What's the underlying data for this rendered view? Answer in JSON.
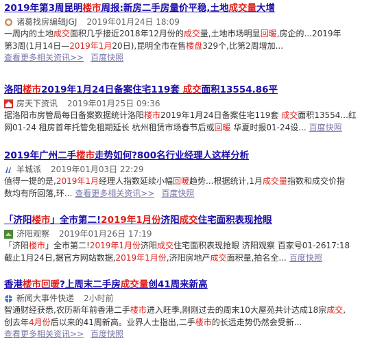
{
  "results": [
    {
      "title": [
        {
          "t": "2019年第3周昆明",
          "h": false
        },
        {
          "t": "楼市",
          "h": true
        },
        {
          "t": "周报:新房二手房量价平稳,土地",
          "h": false
        },
        {
          "t": "成交量",
          "h": true
        },
        {
          "t": "大增",
          "h": false
        }
      ],
      "source_icon": "clock-circle-icon",
      "source": "诸葛找房编辑JGJ",
      "date": "2019年01月24日 18:09",
      "desc_lines": [
        [
          {
            "t": "一周内的土地",
            "h": false
          },
          {
            "t": "成交",
            "h": true
          },
          {
            "t": "面积几乎接近2018年12月份的",
            "h": false
          },
          {
            "t": "成交",
            "h": true
          },
          {
            "t": "量,土地市场明显",
            "h": false
          },
          {
            "t": "回暖",
            "h": true
          },
          {
            "t": ",房企的...2019年",
            "h": false
          }
        ],
        [
          {
            "t": "第3周(1月14日—",
            "h": false
          },
          {
            "t": "2019年1月",
            "h": true
          },
          {
            "t": "20日),昆明全市在售",
            "h": false
          },
          {
            "t": "楼盘",
            "h": true
          },
          {
            "t": "329个,比第2周增加...",
            "h": false
          }
        ]
      ],
      "links": [
        "查看更多相关资讯>>",
        "百度快照"
      ],
      "links_on_new_line": true
    },
    {
      "title": [
        {
          "t": "洛阳",
          "h": false
        },
        {
          "t": "楼市",
          "h": true
        },
        {
          "t": "2019年1月24日备案住宅119套 ",
          "h": false
        },
        {
          "t": "成交",
          "h": true
        },
        {
          "t": "面积13554.86平",
          "h": false
        }
      ],
      "source_icon": "house-icon",
      "source": "房天下资讯",
      "date": "2019年01月25日 09:36",
      "desc_lines": [
        [
          {
            "t": "据洛阳市房管局每日备案数据统计洛阳",
            "h": false
          },
          {
            "t": "楼市",
            "h": true
          },
          {
            "t": "2019年1月24日备案住宅119套 ",
            "h": false
          },
          {
            "t": "成交",
            "h": true
          },
          {
            "t": "面积13554...红",
            "h": false
          }
        ],
        [
          {
            "t": "网01-24 租房首年托管免租期延长 杭州租赁市场春节后或",
            "h": false
          },
          {
            "t": "回暖",
            "h": true
          },
          {
            "t": " 华夏时报01-24设...",
            "h": false
          }
        ]
      ],
      "links": [
        "百度快照"
      ],
      "links_on_new_line": false
    },
    {
      "title": [
        {
          "t": "2019年广州二手",
          "h": false
        },
        {
          "t": "楼市",
          "h": true
        },
        {
          "t": "走势如何?800名行业经理人这样分析",
          "h": false
        }
      ],
      "source_icon": "yangcheng-logo-icon",
      "source": "羊城派",
      "date": "2019年01月03日 22:29",
      "desc_lines": [
        [
          {
            "t": "值得一提的是,",
            "h": false
          },
          {
            "t": "2019年1月",
            "h": true
          },
          {
            "t": "经理人指数延续小幅",
            "h": false
          },
          {
            "t": "回暖",
            "h": true
          },
          {
            "t": "趋势...根据统计,1月",
            "h": false
          },
          {
            "t": "成交量",
            "h": true
          },
          {
            "t": "指数和成交价指",
            "h": false
          }
        ],
        [
          {
            "t": "数均有所回落,环...",
            "h": false
          }
        ]
      ],
      "links": [
        "查看更多相关资讯>>",
        "百度快照"
      ],
      "links_on_new_line": false
    },
    {
      "title": [
        {
          "t": "「济阳",
          "h": false
        },
        {
          "t": "楼市",
          "h": true
        },
        {
          "t": "」全市第二!",
          "h": false
        },
        {
          "t": "2019年1月份",
          "h": true
        },
        {
          "t": "济阳",
          "h": false
        },
        {
          "t": "成交",
          "h": true
        },
        {
          "t": "住宅面积表现抢眼",
          "h": false
        }
      ],
      "source_icon": "jiyang-logo-icon",
      "source": "济阳观察",
      "date": "2019年01月26日 17:19",
      "desc_lines": [
        [
          {
            "t": "「济阳",
            "h": false
          },
          {
            "t": "楼市",
            "h": true
          },
          {
            "t": "」全市第二!",
            "h": false
          },
          {
            "t": "2019年1月份",
            "h": true
          },
          {
            "t": "济阳",
            "h": false
          },
          {
            "t": "成交",
            "h": true
          },
          {
            "t": "住宅面积表现抢眼 济阳观察 百家号01-2617:18",
            "h": false
          }
        ],
        [
          {
            "t": "截止1月24日,据官方网站数据,",
            "h": false
          },
          {
            "t": "2019年1月份",
            "h": true
          },
          {
            "t": ",济阳房地产",
            "h": false
          },
          {
            "t": "成交",
            "h": true
          },
          {
            "t": "面积量,拍名全...",
            "h": false
          }
        ]
      ],
      "links": [
        "百度快照"
      ],
      "links_on_new_line": false
    },
    {
      "title": [
        {
          "t": "香港",
          "h": false
        },
        {
          "t": "楼市回暖",
          "h": true
        },
        {
          "t": "?上周末二手房",
          "h": false
        },
        {
          "t": "成交量",
          "h": true
        },
        {
          "t": "创41周来新高",
          "h": false
        }
      ],
      "source_icon": "news-globe-icon",
      "source": "新闻大事件快递",
      "date": "2小时前",
      "desc_lines": [
        [
          {
            "t": "智通财经获悉,农历新年前香港二手",
            "h": false
          },
          {
            "t": "楼市",
            "h": true
          },
          {
            "t": "进入旺季,刚刚过去的周末10大屋苑共计达成18宗",
            "h": false
          },
          {
            "t": "成交",
            "h": true
          },
          {
            "t": ",",
            "h": false
          }
        ],
        [
          {
            "t": "创去年",
            "h": false
          },
          {
            "t": "4月份",
            "h": true
          },
          {
            "t": "后以来的41周新高。业界人士指出,二手",
            "h": false
          },
          {
            "t": "楼市",
            "h": true
          },
          {
            "t": "的长远走势仍然会受新...",
            "h": false
          }
        ]
      ],
      "links": [
        "查看更多相关资讯>>",
        "百度快照"
      ],
      "links_on_new_line": true
    }
  ],
  "colors": {
    "title": "#1a0dab",
    "highlight": "#e0201c",
    "link": "#7777aa",
    "text": "#333333"
  }
}
